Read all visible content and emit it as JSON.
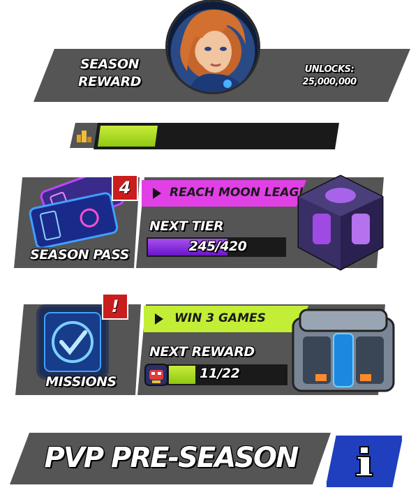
{
  "season": {
    "title_line1": "SEASON",
    "title_line2": "REWARD",
    "unlocks_label": "UNLOCKS:",
    "unlocks_value": "25,000,000",
    "progress_fraction": 0.25
  },
  "season_pass": {
    "label": "SEASON PASS",
    "badge": "4",
    "goal": "REACH MOON LEAGUE",
    "tier_label": "NEXT TIER",
    "progress_text": "245/420",
    "progress_current": 245,
    "progress_total": 420
  },
  "missions": {
    "label": "MISSIONS",
    "badge": "!",
    "goal": "WIN 3 GAMES",
    "reward_label": "NEXT REWARD",
    "progress_text": "11/22",
    "progress_current": 11,
    "progress_total": 22
  },
  "footer": {
    "title": "PVP PRE-SEASON",
    "info_icon": "info-icon"
  },
  "colors": {
    "panel": "#555555",
    "lime": "#c3ee36",
    "magenta": "#e040e6",
    "purple_fill": "#8a2be2",
    "badge_red": "#c81e1e",
    "info_blue": "#1f3fbf"
  }
}
